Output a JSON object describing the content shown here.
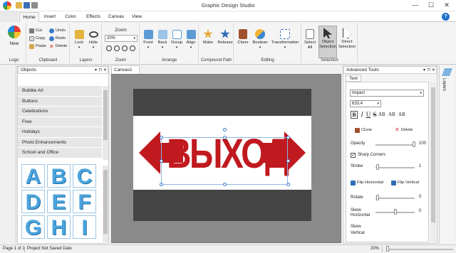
{
  "window": {
    "title": "Graphic Design Studio",
    "min": "—",
    "max": "☐",
    "close": "✕"
  },
  "tabs": [
    "Home",
    "Insert",
    "Color",
    "Effects",
    "Canvas",
    "View"
  ],
  "ribbon": {
    "new": "New",
    "logo_group": "Logo",
    "cut": "Cut",
    "copy": "Copy",
    "paste": "Paste",
    "undo": "Undo",
    "redo": "Redo",
    "delete": "Delete",
    "clipboard_group": "Clipboard",
    "lock": "Lock",
    "hide": "Hide",
    "layers_group": "Layers",
    "zoom_title": "Zoom",
    "zoom_value": "20%",
    "zoom_group": "Zoom",
    "front": "Front",
    "back": "Back",
    "group": "Group",
    "align": "Align",
    "arrange_group": "Arrange",
    "make": "Make",
    "release": "Release",
    "compound_group": "Compound Path",
    "clone": "Clone",
    "boolean": "Boolean",
    "transformation": "Transformation",
    "editing_group": "Editing",
    "select_all": "Select All",
    "object_selection": "Object Selection",
    "direct_selection": "Direct Selection",
    "selection_group": "Selection"
  },
  "objects": {
    "title": "Objects",
    "items": [
      "Bubble Art",
      "Buttons",
      "Celebrations",
      "Free",
      "Holidays",
      "Photo Enhancements",
      "School and Office"
    ],
    "letters": [
      "A",
      "B",
      "C",
      "D",
      "E",
      "F",
      "G",
      "H",
      "I"
    ]
  },
  "canvas": {
    "tab": "Canvas1",
    "text": "ВЫХОД"
  },
  "adv": {
    "title": "Advanced Tools",
    "tab": "Text",
    "font": "Impact",
    "size": "633,4",
    "styles": [
      "B",
      "I",
      "U",
      "S",
      "AB",
      "AB",
      "AB"
    ],
    "clone": "Clone",
    "delete": "Delete",
    "opacity": "Opacity",
    "opacity_val": "100",
    "sharp": "Sharp Corners",
    "stroke": "Stroke",
    "stroke_val": "1",
    "flip_h": "Flip Horizontal",
    "flip_v": "Flip Vertical",
    "rotate": "Rotate",
    "rotate_val": "0",
    "skew_h": "Skew Horizontal",
    "skew_h_val": "0",
    "skew_v": "Skew Vertical"
  },
  "layers": "Layers",
  "status": {
    "page": "Page 1 of 1",
    "saved": "Project Not Saved",
    "date": "Date",
    "zoom": "20%"
  },
  "colors": {
    "accent": "#1e6fc7",
    "arrow": "#c0191f"
  },
  "chrome_glyphs": {
    "pin": "⊓",
    "close": "✕",
    "dropdown": "▾",
    "help": "?",
    "check": "✓"
  }
}
